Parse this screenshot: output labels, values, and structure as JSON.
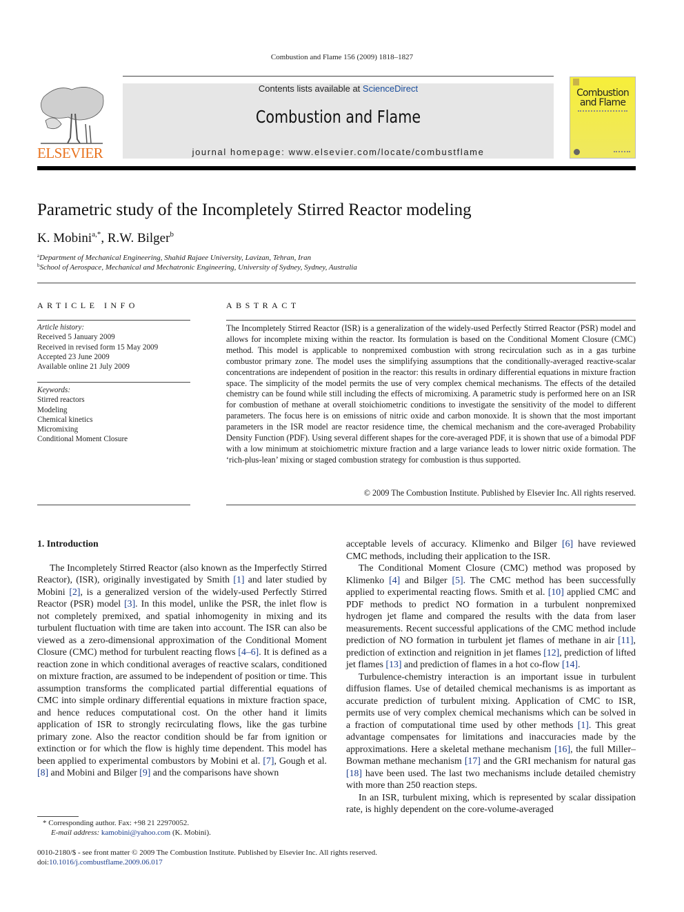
{
  "running_head": "Combustion and Flame 156 (2009) 1818–1827",
  "header": {
    "contents_prefix": "Contents lists available at ",
    "contents_link": "ScienceDirect",
    "journal_title": "Combustion and Flame",
    "homepage": "journal homepage: www.elsevier.com/locate/combustflame",
    "publisher_logo_text": "ELSEVIER",
    "cover_title_line1": "Combustion",
    "cover_title_line2": "and Flame",
    "accent_color": "#e8731f",
    "link_color": "#1a3c8c",
    "cover_color": "#f4ec3c"
  },
  "article": {
    "title": "Parametric study of the Incompletely Stirred Reactor modeling",
    "authors": [
      {
        "name": "K. Mobini",
        "sup": "a,*"
      },
      {
        "name": "R.W. Bilger",
        "sup": "b"
      }
    ],
    "affiliations": [
      {
        "mark": "a",
        "text": "Department of Mechanical Engineering, Shahid Rajaee University, Lavizan, Tehran, Iran"
      },
      {
        "mark": "b",
        "text": "School of Aerospace, Mechanical and Mechatronic Engineering, University of Sydney, Sydney, Australia"
      }
    ]
  },
  "article_info": {
    "heading": "ARTICLE INFO",
    "history_label": "Article history:",
    "history": [
      "Received 5 January 2009",
      "Received in revised form 15 May 2009",
      "Accepted 23 June 2009",
      "Available online 21 July 2009"
    ],
    "keywords_label": "Keywords:",
    "keywords": [
      "Stirred reactors",
      "Modeling",
      "Chemical kinetics",
      "Micromixing",
      "Conditional Moment Closure"
    ]
  },
  "abstract": {
    "heading": "ABSTRACT",
    "text": "The Incompletely Stirred Reactor (ISR) is a generalization of the widely-used Perfectly Stirred Reactor (PSR) model and allows for incomplete mixing within the reactor. Its formulation is based on the Conditional Moment Closure (CMC) method. This model is applicable to nonpremixed combustion with strong recirculation such as in a gas turbine combustor primary zone. The model uses the simplifying assumptions that the conditionally-averaged reactive-scalar concentrations are independent of position in the reactor: this results in ordinary differential equations in mixture fraction space. The simplicity of the model permits the use of very complex chemical mechanisms. The effects of the detailed chemistry can be found while still including the effects of micromixing. A parametric study is performed here on an ISR for combustion of methane at overall stoichiometric conditions to investigate the sensitivity of the model to different parameters. The focus here is on emissions of nitric oxide and carbon monoxide. It is shown that the most important parameters in the ISR model are reactor residence time, the chemical mechanism and the core-averaged Probability Density Function (PDF). Using several different shapes for the core-averaged PDF, it is shown that use of a bimodal PDF with a low minimum at stoichiometric mixture fraction and a large variance leads to lower nitric oxide formation. The ‘rich-plus-lean’ mixing or staged combustion strategy for combustion is thus supported.",
    "copyright": "© 2009 The Combustion Institute. Published by Elsevier Inc. All rights reserved."
  },
  "body": {
    "section_heading": "1. Introduction",
    "p1": [
      {
        "t": "The Incompletely Stirred Reactor (also known as the Imperfectly Stirred Reactor), (ISR), originally investigated by Smith "
      },
      {
        "r": "[1]"
      },
      {
        "t": " and later studied by Mobini "
      },
      {
        "r": "[2]"
      },
      {
        "t": ", is a generalized version of the widely-used Perfectly Stirred Reactor (PSR) model "
      },
      {
        "r": "[3]"
      },
      {
        "t": ". In this model, unlike the PSR, the inlet flow is not completely premixed, and spatial inhomogenity in mixing and its turbulent fluctuation with time are taken into account. The ISR can also be viewed as a zero-dimensional approximation of the Conditional Moment Closure (CMC) method for turbulent reacting flows "
      },
      {
        "r": "[4–6]"
      },
      {
        "t": ". It is defined as a reaction zone in which conditional averages of reactive scalars, conditioned on mixture fraction, are assumed to be independent of position or time. This assumption transforms the complicated partial differential equations of CMC into simple ordinary differential equations in mixture fraction space, and hence reduces computational cost. On the other hand it limits application of ISR to strongly recirculating flows, like the gas turbine primary zone. Also the reactor condition should be far from ignition or extinction or for which the flow is highly time dependent. This model has been applied to experimental combustors by Mobini et al. "
      },
      {
        "r": "[7]"
      },
      {
        "t": ", Gough et al. "
      },
      {
        "r": "[8]"
      },
      {
        "t": " and Mobini and Bilger "
      },
      {
        "r": "[9]"
      },
      {
        "t": " and the comparisons have shown acceptable levels of accuracy. Klimenko and Bilger "
      },
      {
        "r": "[6]"
      },
      {
        "t": " have reviewed CMC methods, including their application to the ISR."
      }
    ],
    "p2": [
      {
        "t": "The Conditional Moment Closure (CMC) method was proposed by Klimenko "
      },
      {
        "r": "[4]"
      },
      {
        "t": " and Bilger "
      },
      {
        "r": "[5]"
      },
      {
        "t": ". The CMC method has been successfully applied to experimental reacting flows. Smith et al. "
      },
      {
        "r": "[10]"
      },
      {
        "t": " applied CMC and PDF methods to predict NO formation in a turbulent nonpremixed hydrogen jet flame and compared the results with the data from laser measurements. Recent successful applications of the CMC method include prediction of NO formation in turbulent jet flames of methane in air "
      },
      {
        "r": "[11]"
      },
      {
        "t": ", prediction of extinction and reignition in jet flames "
      },
      {
        "r": "[12]"
      },
      {
        "t": ", prediction of lifted jet flames "
      },
      {
        "r": "[13]"
      },
      {
        "t": " and prediction of flames in a hot co-flow "
      },
      {
        "r": "[14]"
      },
      {
        "t": "."
      }
    ],
    "p3": [
      {
        "t": "Turbulence-chemistry interaction is an important issue in turbulent diffusion flames. Use of detailed chemical mechanisms is as important as accurate prediction of turbulent mixing. Application of CMC to ISR, permits use of very complex chemical mechanisms which can be solved in a fraction of computational time used by other methods "
      },
      {
        "r": "[1]"
      },
      {
        "t": ". This great advantage compensates for limitations and inaccuracies made by the approximations. Here a skeletal methane mechanism "
      },
      {
        "r": "[16]"
      },
      {
        "t": ", the full Miller–Bowman methane mechanism "
      },
      {
        "r": "[17]"
      },
      {
        "t": " and the GRI mechanism for natural gas "
      },
      {
        "r": "[18]"
      },
      {
        "t": " have been used. The last two mechanisms include detailed chemistry with more than 250 reaction steps."
      }
    ],
    "p4": [
      {
        "t": "In an ISR, turbulent mixing, which is represented by scalar dissipation rate, is highly dependent on the core-volume-averaged"
      }
    ]
  },
  "footnote": {
    "line1": "* Corresponding author. Fax: +98 21 22970052.",
    "email_label": "E-mail address: ",
    "email": "kamobini@yahoo.com",
    "email_suffix": " (K. Mobini)."
  },
  "frontmatter": {
    "line1": "0010-2180/$ - see front matter © 2009 The Combustion Institute. Published by Elsevier Inc. All rights reserved.",
    "doi_prefix": "doi:",
    "doi": "10.1016/j.combustflame.2009.06.017"
  }
}
